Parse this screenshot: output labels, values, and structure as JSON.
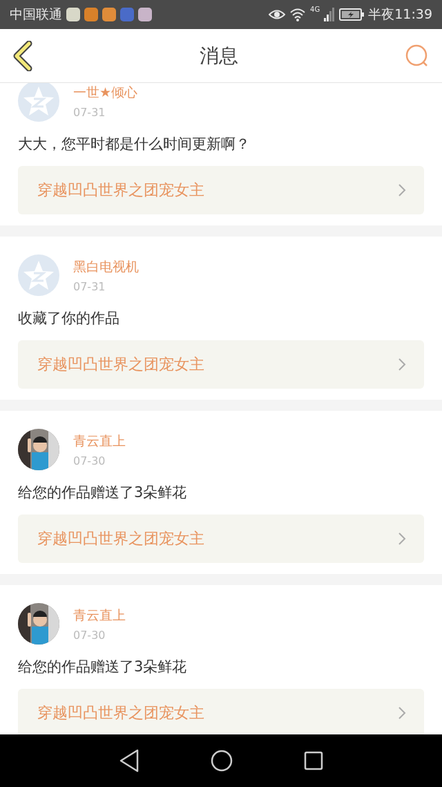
{
  "status_bar": {
    "carrier": "中国联通",
    "time": "半夜11:39",
    "network": "4G"
  },
  "header": {
    "title": "消息"
  },
  "messages": [
    {
      "avatar": {
        "kind": "default"
      },
      "name": "一世★倾心",
      "date": "07-31",
      "text": "大大，您平时都是什么时间更新啊？",
      "book": "穿越凹凸世界之团宠女主"
    },
    {
      "avatar": {
        "kind": "default"
      },
      "name": "黑白电视机",
      "date": "07-31",
      "text": "收藏了你的作品",
      "book": "穿越凹凸世界之团宠女主"
    },
    {
      "name": "青云直上",
      "date": "07-30",
      "text": "给您的作品赠送了3朵鲜花",
      "book": "穿越凹凸世界之团宠女主"
    },
    {
      "name": "青云直上",
      "date": "07-30",
      "text": "给您的作品赠送了3朵鲜花",
      "book": "穿越凹凸世界之团宠女主"
    }
  ]
}
